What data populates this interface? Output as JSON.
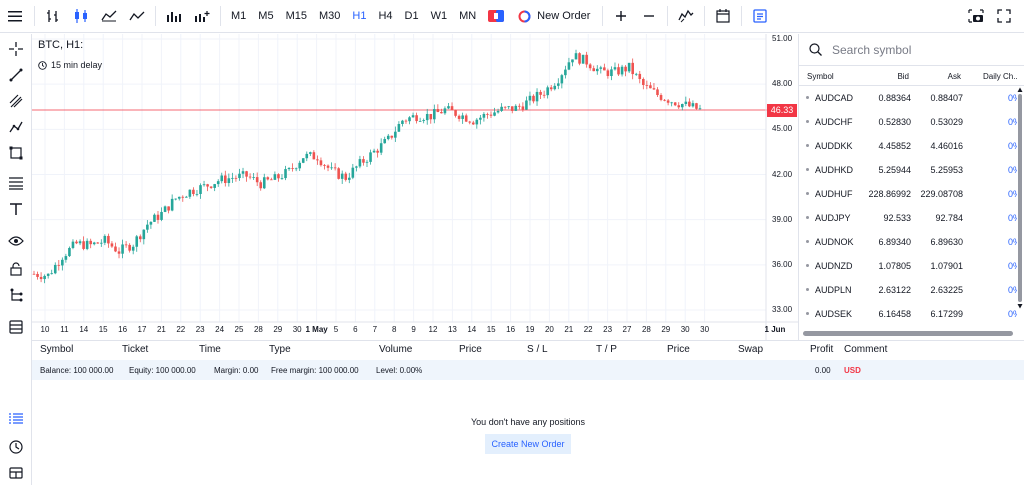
{
  "toolbar": {
    "timeframes": [
      "M1",
      "M5",
      "M15",
      "M30",
      "H1",
      "H4",
      "D1",
      "W1",
      "MN"
    ],
    "active_timeframe": "H1",
    "new_order_label": "New Order",
    "colors": {
      "accent": "#2962ff",
      "up": "#26a69a",
      "down": "#ef5350"
    }
  },
  "chart": {
    "title": "BTC, H1:",
    "delay_label": "15 min delay",
    "price_labels": [
      "51.00",
      "48.00",
      "45.00",
      "42.00",
      "39.00",
      "36.00",
      "33.00"
    ],
    "last_price": "46.33",
    "date_labels": [
      "10",
      "11",
      "14",
      "15",
      "16",
      "17",
      "21",
      "22",
      "23",
      "24",
      "25",
      "28",
      "29",
      "30",
      "1 May",
      "5",
      "6",
      "7",
      "8",
      "9",
      "12",
      "13",
      "14",
      "15",
      "16",
      "19",
      "20",
      "21",
      "22",
      "23",
      "27",
      "28",
      "29",
      "30",
      "30",
      "1 Jun"
    ]
  },
  "chart_data": {
    "type": "candlestick",
    "title": "BTC, H1:",
    "ylim": [
      32.5,
      51.3
    ],
    "y_ticks": [
      33.0,
      36.0,
      39.0,
      42.0,
      45.0,
      48.0,
      51.0
    ],
    "last_price": 46.33,
    "x_labels": [
      "10",
      "11",
      "14",
      "15",
      "16",
      "17",
      "21",
      "22",
      "23",
      "24",
      "25",
      "28",
      "29",
      "30",
      "1 May",
      "5",
      "6",
      "7",
      "8",
      "9",
      "12",
      "13",
      "14",
      "15",
      "16",
      "19",
      "20",
      "21",
      "22",
      "23",
      "27",
      "28",
      "29",
      "30",
      "30",
      "1 Jun"
    ],
    "close_path": [
      [
        0,
        35.4
      ],
      [
        4,
        35.3
      ],
      [
        8,
        36.6
      ],
      [
        12,
        37.4
      ],
      [
        16,
        37.3
      ],
      [
        20,
        37.6
      ],
      [
        24,
        36.9
      ],
      [
        28,
        37.4
      ],
      [
        32,
        38.7
      ],
      [
        36,
        39.4
      ],
      [
        40,
        40.4
      ],
      [
        44,
        40.9
      ],
      [
        48,
        41.2
      ],
      [
        52,
        41.6
      ],
      [
        56,
        41.8
      ],
      [
        60,
        41.9
      ],
      [
        64,
        41.4
      ],
      [
        68,
        41.7
      ],
      [
        72,
        42.2
      ],
      [
        76,
        43.2
      ],
      [
        80,
        43.2
      ],
      [
        84,
        42.2
      ],
      [
        88,
        41.8
      ],
      [
        92,
        42.7
      ],
      [
        96,
        43.5
      ],
      [
        100,
        44.3
      ],
      [
        104,
        45.6
      ],
      [
        108,
        45.9
      ],
      [
        112,
        45.9
      ],
      [
        116,
        46.3
      ],
      [
        120,
        46.0
      ],
      [
        124,
        45.6
      ],
      [
        128,
        46.0
      ],
      [
        132,
        46.3
      ],
      [
        136,
        46.4
      ],
      [
        140,
        46.9
      ],
      [
        144,
        47.5
      ],
      [
        148,
        48.4
      ],
      [
        152,
        49.9
      ],
      [
        156,
        49.5
      ],
      [
        160,
        48.8
      ],
      [
        164,
        48.8
      ],
      [
        168,
        49.1
      ],
      [
        172,
        47.9
      ],
      [
        176,
        47.3
      ],
      [
        180,
        46.9
      ],
      [
        184,
        46.6
      ],
      [
        188,
        46.3
      ]
    ]
  },
  "market": {
    "search_placeholder": "Search symbol",
    "headers": {
      "symbol": "Symbol",
      "bid": "Bid",
      "ask": "Ask",
      "change": "Daily Ch..."
    },
    "rows": [
      {
        "symbol": "AUDCAD",
        "bid": "0.88364",
        "ask": "0.88407",
        "change": "0%"
      },
      {
        "symbol": "AUDCHF",
        "bid": "0.52830",
        "ask": "0.53029",
        "change": "0%"
      },
      {
        "symbol": "AUDDKK",
        "bid": "4.45852",
        "ask": "4.46016",
        "change": "0%"
      },
      {
        "symbol": "AUDHKD",
        "bid": "5.25944",
        "ask": "5.25953",
        "change": "0%"
      },
      {
        "symbol": "AUDHUF",
        "bid": "228.86992",
        "ask": "229.08708",
        "change": "0%"
      },
      {
        "symbol": "AUDJPY",
        "bid": "92.533",
        "ask": "92.784",
        "change": "0%"
      },
      {
        "symbol": "AUDNOK",
        "bid": "6.89340",
        "ask": "6.89630",
        "change": "0%"
      },
      {
        "symbol": "AUDNZD",
        "bid": "1.07805",
        "ask": "1.07901",
        "change": "0%"
      },
      {
        "symbol": "AUDPLN",
        "bid": "2.63122",
        "ask": "2.63225",
        "change": "0%"
      },
      {
        "symbol": "AUDSEK",
        "bid": "6.16458",
        "ask": "6.17299",
        "change": "0%"
      }
    ]
  },
  "positions": {
    "headers": [
      "Symbol",
      "Ticket",
      "Time",
      "Type",
      "Volume",
      "Price",
      "S / L",
      "T / P",
      "Price",
      "Swap",
      "Profit",
      "Comment"
    ],
    "balance": {
      "balance": "Balance: 100 000.00",
      "equity": "Equity: 100 000.00",
      "margin": "Margin: 0.00",
      "free_margin": "Free margin: 100 000.00",
      "level": "Level: 0.00%",
      "profit": "0.00",
      "currency": "USD"
    },
    "empty_message": "You don't have any positions",
    "create_button": "Create New Order"
  }
}
